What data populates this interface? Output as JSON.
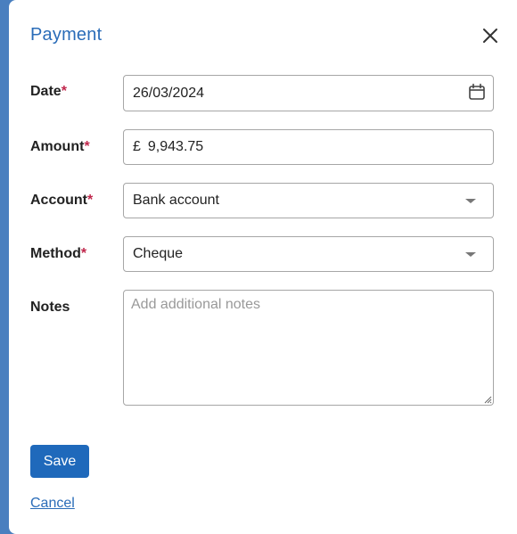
{
  "dialog": {
    "title": "Payment",
    "close_icon": "close-icon"
  },
  "form": {
    "date": {
      "label": "Date",
      "required_mark": "*",
      "value": "26/03/2024",
      "icon": "calendar-icon"
    },
    "amount": {
      "label": "Amount",
      "required_mark": "*",
      "currency_symbol": "£",
      "value": "9,943.75"
    },
    "account": {
      "label": "Account",
      "required_mark": "*",
      "selected": "Bank account",
      "icon": "chevron-down-icon"
    },
    "method": {
      "label": "Method",
      "required_mark": "*",
      "selected": "Cheque",
      "icon": "chevron-down-icon"
    },
    "notes": {
      "label": "Notes",
      "placeholder": "Add additional notes",
      "value": ""
    }
  },
  "actions": {
    "save_label": "Save",
    "cancel_label": "Cancel"
  },
  "colors": {
    "accent": "#1f69bb",
    "title": "#2a6cb8",
    "required": "#c0264b"
  }
}
